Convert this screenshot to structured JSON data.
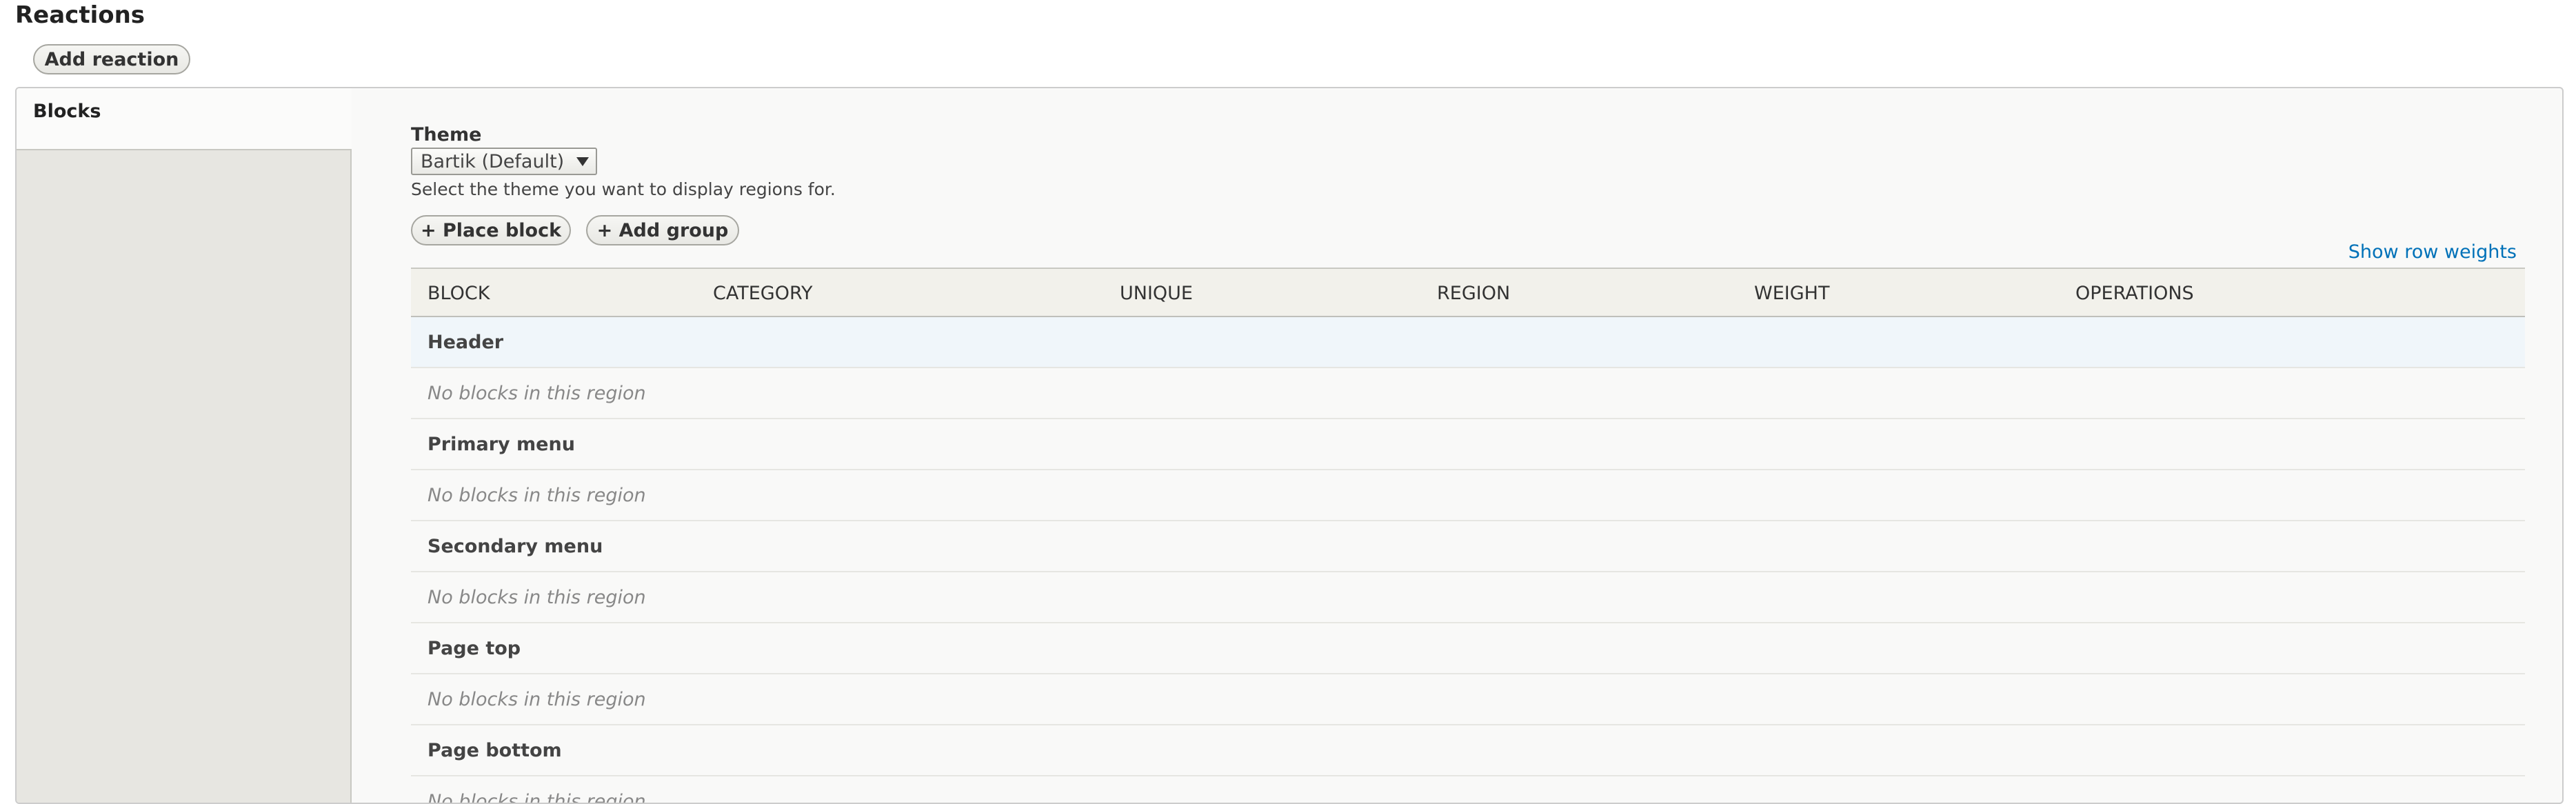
{
  "section": {
    "title": "Reactions",
    "add_reaction_label": "Add reaction"
  },
  "vertical_tabs": {
    "active_label": "Blocks"
  },
  "theme": {
    "label": "Theme",
    "selected": "Bartik (Default)",
    "description": "Select the theme you want to display regions for."
  },
  "actions": {
    "place_block_label": "+ Place block",
    "add_group_label": "+ Add group",
    "show_row_weights": "Show row weights"
  },
  "table": {
    "headers": [
      "Block",
      "Category",
      "Unique",
      "Region",
      "Weight",
      "Operations"
    ],
    "rows": [
      {
        "type": "region",
        "text": "Header"
      },
      {
        "type": "empty",
        "text": "No blocks in this region"
      },
      {
        "type": "region",
        "text": "Primary menu"
      },
      {
        "type": "empty",
        "text": "No blocks in this region"
      },
      {
        "type": "region",
        "text": "Secondary menu"
      },
      {
        "type": "empty",
        "text": "No blocks in this region"
      },
      {
        "type": "region",
        "text": "Page top"
      },
      {
        "type": "empty",
        "text": "No blocks in this region"
      },
      {
        "type": "region",
        "text": "Page bottom"
      },
      {
        "type": "empty",
        "text": "No blocks in this region"
      }
    ]
  },
  "colors": {
    "link": "#0071b8",
    "highlight_row": "#f0f6fa",
    "tab_background": "#e7e6e1"
  }
}
